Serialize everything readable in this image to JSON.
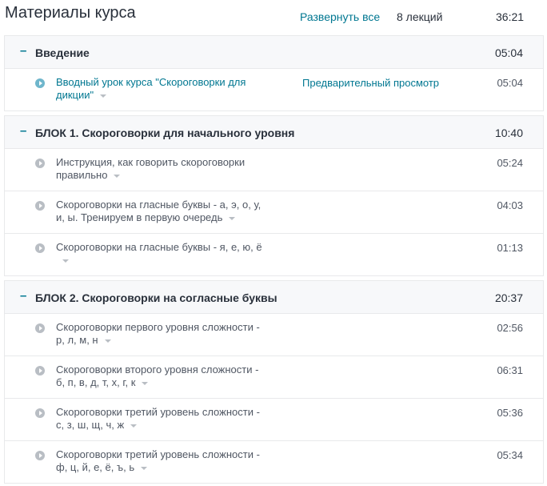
{
  "header": {
    "title": "Материалы курса",
    "expand_all": "Развернуть все",
    "lectures_count": "8 лекций",
    "total_duration": "36:21"
  },
  "sections": [
    {
      "toggle": "–",
      "title": "Введение",
      "duration": "05:04",
      "lectures": [
        {
          "line1": "Вводный урок курса \"Скороговорки для",
          "line2": "дикции\"",
          "preview": "Предварительный просмотр",
          "duration": "05:04"
        }
      ]
    },
    {
      "toggle": "–",
      "title": "БЛОК 1. Скороговорки для начального уровня",
      "duration": "10:40",
      "lectures": [
        {
          "line1": "Инструкция, как говорить скороговорки",
          "line2": "правильно",
          "duration": "05:24"
        },
        {
          "line1": "Скороговорки на гласные буквы - а, э, о, у,",
          "line2": "и, ы. Тренируем в первую очередь",
          "duration": "04:03"
        },
        {
          "line1": "Скороговорки на гласные буквы - я, е, ю, ё",
          "line2": "",
          "duration": "01:13"
        }
      ]
    },
    {
      "toggle": "–",
      "title": "БЛОК 2. Скороговорки на согласные буквы",
      "duration": "20:37",
      "lectures": [
        {
          "line1": "Скороговорки первого уровня сложности -",
          "line2": "р, л, м, н",
          "duration": "02:56"
        },
        {
          "line1": "Скороговорки второго уровня сложности -",
          "line2": "б, п, в, д, т, х, г, к",
          "duration": "06:31"
        },
        {
          "line1": "Скороговорки третий уровень сложности -",
          "line2": "с, з, ш, щ, ч, ж",
          "duration": "05:36"
        },
        {
          "line1": "Скороговорки третий уровень сложности -",
          "line2": "ф, ц, й, е, ё, ъ, ь",
          "duration": "05:34"
        }
      ]
    }
  ]
}
